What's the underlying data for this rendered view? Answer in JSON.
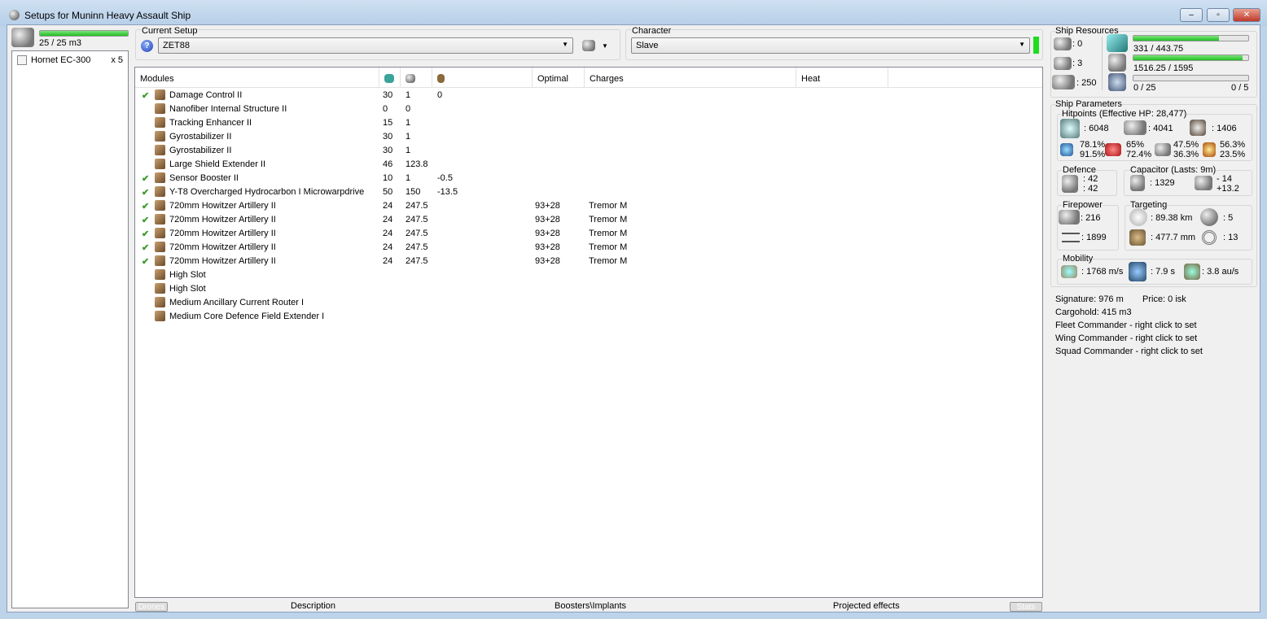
{
  "window": {
    "title": "Setups for Muninn Heavy Assault Ship",
    "min": "–",
    "max": "▫",
    "close": "✕"
  },
  "drones": {
    "bay": "25 / 25 m3",
    "bay_fill": 1.0,
    "items": [
      {
        "name": "Hornet EC-300",
        "qty": "x 5"
      }
    ]
  },
  "setup": {
    "label": "Current Setup",
    "value": "ZET88"
  },
  "character": {
    "label": "Character",
    "value": "Slave"
  },
  "columns": [
    "Modules",
    "",
    "",
    "",
    "Optimal",
    "Charges",
    "Heat"
  ],
  "modules": [
    {
      "active": true,
      "name": "Damage Control II",
      "cpu": "30",
      "pg": "1",
      "cap": "0",
      "optimal": "",
      "charges": ""
    },
    {
      "active": false,
      "name": "Nanofiber Internal Structure II",
      "cpu": "0",
      "pg": "0",
      "cap": "",
      "optimal": "",
      "charges": ""
    },
    {
      "active": false,
      "name": "Tracking Enhancer II",
      "cpu": "15",
      "pg": "1",
      "cap": "",
      "optimal": "",
      "charges": ""
    },
    {
      "active": false,
      "name": "Gyrostabilizer II",
      "cpu": "30",
      "pg": "1",
      "cap": "",
      "optimal": "",
      "charges": ""
    },
    {
      "active": false,
      "name": "Gyrostabilizer II",
      "cpu": "30",
      "pg": "1",
      "cap": "",
      "optimal": "",
      "charges": ""
    },
    {
      "active": false,
      "name": "Large Shield Extender II",
      "cpu": "46",
      "pg": "123.8",
      "cap": "",
      "optimal": "",
      "charges": ""
    },
    {
      "active": true,
      "name": "Sensor Booster II",
      "cpu": "10",
      "pg": "1",
      "cap": "-0.5",
      "optimal": "",
      "charges": ""
    },
    {
      "active": true,
      "name": "Y-T8 Overcharged Hydrocarbon I Microwarpdrive",
      "cpu": "50",
      "pg": "150",
      "cap": "-13.5",
      "optimal": "",
      "charges": ""
    },
    {
      "active": true,
      "name": "720mm Howitzer Artillery II",
      "cpu": "24",
      "pg": "247.5",
      "cap": "",
      "optimal": "93+28",
      "charges": "Tremor M"
    },
    {
      "active": true,
      "name": "720mm Howitzer Artillery II",
      "cpu": "24",
      "pg": "247.5",
      "cap": "",
      "optimal": "93+28",
      "charges": "Tremor M"
    },
    {
      "active": true,
      "name": "720mm Howitzer Artillery II",
      "cpu": "24",
      "pg": "247.5",
      "cap": "",
      "optimal": "93+28",
      "charges": "Tremor M"
    },
    {
      "active": true,
      "name": "720mm Howitzer Artillery II",
      "cpu": "24",
      "pg": "247.5",
      "cap": "",
      "optimal": "93+28",
      "charges": "Tremor M"
    },
    {
      "active": true,
      "name": "720mm Howitzer Artillery II",
      "cpu": "24",
      "pg": "247.5",
      "cap": "",
      "optimal": "93+28",
      "charges": "Tremor M"
    },
    {
      "active": false,
      "name": "High Slot",
      "cpu": "",
      "pg": "",
      "cap": "",
      "optimal": "",
      "charges": ""
    },
    {
      "active": false,
      "name": "High Slot",
      "cpu": "",
      "pg": "",
      "cap": "",
      "optimal": "",
      "charges": ""
    },
    {
      "active": false,
      "name": "Medium Ancillary Current Router I",
      "cpu": "",
      "pg": "",
      "cap": "",
      "optimal": "",
      "charges": ""
    },
    {
      "active": false,
      "name": "Medium Core Defence Field Extender I",
      "cpu": "",
      "pg": "",
      "cap": "",
      "optimal": "",
      "charges": ""
    }
  ],
  "tabs": {
    "drones": "Drones",
    "description": "Description",
    "boosters": "Boosters\\Implants",
    "projected": "Projected effects",
    "stats": "Stats"
  },
  "resources": {
    "title": "Ship Resources",
    "turrets": ": 0",
    "launchers": ": 3",
    "calibration": ": 250",
    "cpu": "331 / 443.75",
    "cpu_fill": 0.746,
    "pg": "1516.25 / 1595",
    "pg_fill": 0.951,
    "drone_bw": "0 / 25",
    "drones_active": "0 / 5",
    "drone_fill": 0
  },
  "params": {
    "title": "Ship Parameters",
    "hp_title": "Hitpoints (Effective HP: 28,477)",
    "shield": ": 6048",
    "armor": ": 4041",
    "structure": ": 1406",
    "res": [
      [
        "78.1%",
        "91.5%"
      ],
      [
        "65%",
        "72.4%"
      ],
      [
        "47.5%",
        "36.3%"
      ],
      [
        "56.3%",
        "23.5%"
      ]
    ],
    "defence_title": "Defence",
    "def1": ": 42",
    "def2": ": 42",
    "cap_title": "Capacitor (Lasts: 9m)",
    "cap": ": 1329",
    "cap_use": "- 14",
    "cap_regen": "+13.2",
    "fire_title": "Firepower",
    "dps": ": 216",
    "volley": ": 1899",
    "target_title": "Targeting",
    "range": ": 89.38 km",
    "targets": ": 5",
    "scan": ": 477.7 mm",
    "sensor": ": 13",
    "mob_title": "Mobility",
    "speed": ": 1768 m/s",
    "align": ": 7.9 s",
    "warp": ": 3.8 au/s",
    "signature": "Signature: 976 m",
    "price": "Price: 0 isk",
    "cargo": "Cargohold: 415 m3",
    "fleet": "Fleet Commander - right click to set",
    "wing": "Wing Commander - right click to set",
    "squad": "Squad Commander - right click to set"
  }
}
